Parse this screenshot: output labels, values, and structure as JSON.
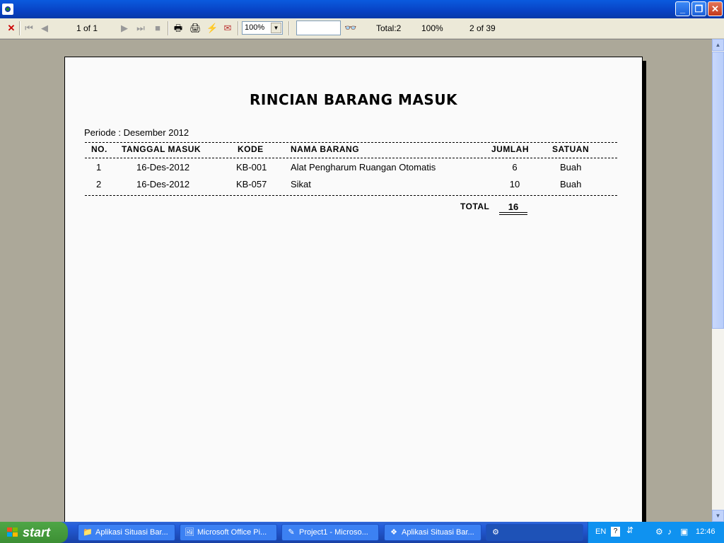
{
  "toolbar": {
    "page_indicator": "1 of 1",
    "zoom_value": "100%",
    "total": "Total:2",
    "percent": "100%",
    "record": "2 of 39"
  },
  "report": {
    "title": "RINCIAN BARANG MASUK",
    "periode": "Periode :  Desember 2012",
    "columns": [
      "NO.",
      "TANGGAL MASUK",
      "KODE",
      "NAMA BARANG",
      "JUMLAH",
      "SATUAN"
    ],
    "rows": [
      {
        "no": "1",
        "tanggal": "16-Des-2012",
        "kode": "KB-001",
        "nama": "Alat Pengharum Ruangan Otomatis",
        "jumlah": "6",
        "satuan": "Buah"
      },
      {
        "no": "2",
        "tanggal": "16-Des-2012",
        "kode": "KB-057",
        "nama": "Sikat",
        "jumlah": "10",
        "satuan": "Buah"
      }
    ],
    "total_label": "TOTAL",
    "total_value": "16"
  },
  "taskbar": {
    "start_label": "start",
    "tasks": [
      {
        "label": "Aplikasi Situasi Bar..."
      },
      {
        "label": "Microsoft Office Pi..."
      },
      {
        "label": "Project1 - Microso..."
      },
      {
        "label": "Aplikasi Situasi Bar..."
      }
    ],
    "language": "EN",
    "clock": "12:46"
  }
}
